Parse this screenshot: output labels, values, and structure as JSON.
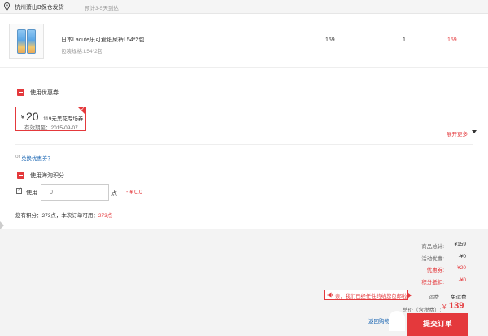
{
  "shipping_bar": {
    "warehouse": "杭州萧山B保仓发货",
    "eta": "预计3-5天到达",
    "icon": "map-pin-icon"
  },
  "product": {
    "name": "日本Lacute乐可爱纸尿裤L54*2包",
    "spec": "包装规格:L54*2包",
    "unit_price": "159",
    "quantity": "1",
    "line_total": "159",
    "thumbnail": "diaper-pack-image"
  },
  "coupon_section": {
    "label": "使用优惠券",
    "coupon": {
      "currency": "¥",
      "amount": "20",
      "description": "119元黑花专场券",
      "validity": "有效期至：2015-09-07"
    },
    "expand_label": "展开更多",
    "or_text": "or",
    "exchange_link": "兑换优惠券？"
  },
  "points_section": {
    "label": "使用海淘积分",
    "use_label": "使用",
    "input_placeholder": "0",
    "unit": "点",
    "deduction": "- ¥ 0.0",
    "info_prefix": "您有积分：",
    "info_points": "273点",
    "info_middle": "，本次订单可用：",
    "info_usable": "273点"
  },
  "summary": {
    "rows": [
      {
        "label": "商品总计:",
        "value": "¥159",
        "highlight": false
      },
      {
        "label": "活动优惠:",
        "value": "-¥0",
        "highlight": false
      },
      {
        "label": "优惠券:",
        "value": "-¥20",
        "highlight": true
      },
      {
        "label": "积分抵扣:",
        "value": "-¥0",
        "highlight": true
      }
    ],
    "shipping_label": "运费",
    "shipping_value": "免运费",
    "free_ship_message": "亲，我们已经任性的给您包邮啦！",
    "total_label": "总价（含税费）:",
    "total_currency": "¥",
    "total_amount": "139",
    "back_link": "返回购物车",
    "submit_label": "提交订单"
  },
  "colors": {
    "accent": "#e4393c",
    "link": "#1a66b3",
    "summary_bg": "#f3f3f3"
  }
}
